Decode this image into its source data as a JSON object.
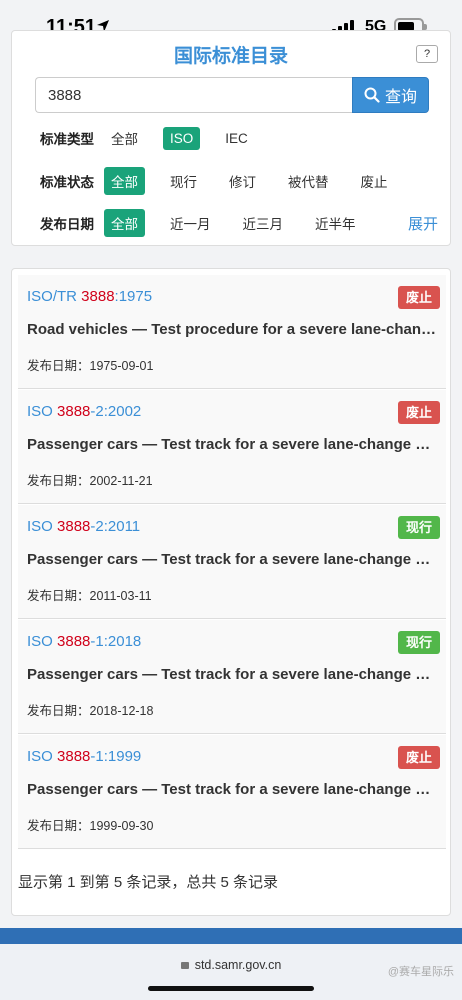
{
  "status_bar": {
    "time": "11:51",
    "network": "5G",
    "battery_level": 0.72
  },
  "filter": {
    "title": "国际标准目录",
    "search_value": "3888",
    "search_button": "查询",
    "rows": [
      {
        "label": "标准类型",
        "options": [
          "全部",
          "ISO",
          "IEC"
        ],
        "selected": "ISO"
      },
      {
        "label": "标准状态",
        "options": [
          "全部",
          "现行",
          "修订",
          "被代替",
          "废止"
        ],
        "selected": "全部"
      },
      {
        "label": "发布日期",
        "options": [
          "全部",
          "近一月",
          "近三月",
          "近半年"
        ],
        "selected": "全部"
      }
    ],
    "expand_link": "展开"
  },
  "results": [
    {
      "prefix": "ISO/TR ",
      "highlight": "3888",
      "suffix": ":1975",
      "status": "废止",
      "status_color": "#d9534f",
      "title": "Road vehicles — Test procedure for a severe lane-change manoeuvre",
      "date_label": "发布日期：",
      "date": "1975-09-01"
    },
    {
      "prefix": "ISO ",
      "highlight": "3888",
      "suffix": "-2:2002",
      "status": "废止",
      "status_color": "#d9534f",
      "title": "Passenger cars — Test track for a severe lane-change manoeuvre",
      "date_label": "发布日期：",
      "date": "2002-11-21"
    },
    {
      "prefix": "ISO ",
      "highlight": "3888",
      "suffix": "-2:2011",
      "status": "现行",
      "status_color": "#52b74a",
      "title": "Passenger cars — Test track for a severe lane-change manoeuvre",
      "date_label": "发布日期：",
      "date": "2011-03-11"
    },
    {
      "prefix": "ISO ",
      "highlight": "3888",
      "suffix": "-1:2018",
      "status": "现行",
      "status_color": "#52b74a",
      "title": "Passenger cars — Test track for a severe lane-change manoeuvre",
      "date_label": "发布日期：",
      "date": "2018-12-18"
    },
    {
      "prefix": "ISO ",
      "highlight": "3888",
      "suffix": "-1:1999",
      "status": "废止",
      "status_color": "#d9534f",
      "title": "Passenger cars — Test track for a severe lane-change manoeuvre",
      "date_label": "发布日期：",
      "date": "1999-09-30"
    }
  ],
  "pager_text": "显示第 1 到第 5 条记录，总共 5 条记录",
  "browser": {
    "url": "std.samr.gov.cn",
    "watermark": "@赛车星际乐"
  }
}
